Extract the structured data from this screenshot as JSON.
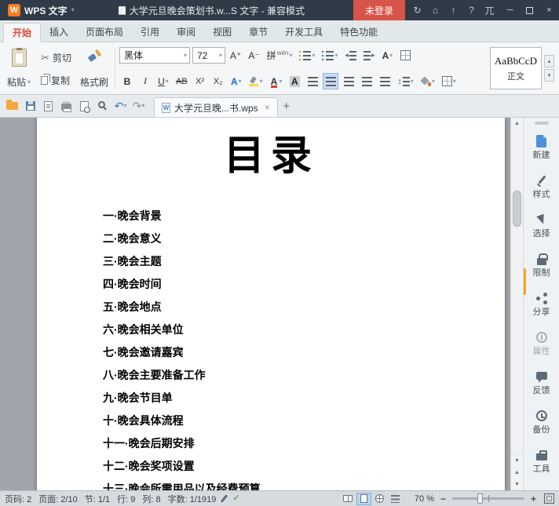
{
  "title_bar": {
    "logo_letter": "W",
    "app_name": "WPS 文字",
    "doc_title": "大学元旦晚会策划书.w...S 文字 - 兼容模式",
    "login_label": "未登录"
  },
  "tabs": [
    "开始",
    "插入",
    "页面布局",
    "引用",
    "审阅",
    "视图",
    "章节",
    "开发工具",
    "特色功能"
  ],
  "ribbon": {
    "paste": "粘贴",
    "cut": "剪切",
    "copy": "复制",
    "format_painter": "格式刷",
    "font_name": "黑体",
    "font_size": "72",
    "grow_font": "A⁺",
    "shrink_font": "A⁻",
    "pinyin": "拼",
    "pinyin_sub": "wén",
    "bold": "B",
    "italic": "I",
    "underline": "U",
    "strikethrough": "AB",
    "superscript": "X²",
    "subscript": "X₂",
    "style_preview": "AaBbCcD",
    "style_name": "正文"
  },
  "quick_bar": {
    "doc_tab": "大学元旦晚...书.wps"
  },
  "document": {
    "heading": "目录",
    "toc": [
      "一·晚会背景",
      "二·晚会意义",
      "三·晚会主题",
      "四·晚会时间",
      "五·晚会地点",
      "六·晚会相关单位",
      "七·晚会邀请嘉宾",
      "八·晚会主要准备工作",
      "九·晚会节目单",
      "十·晚会具体流程",
      "十一·晚会后期安排",
      "十二·晚会奖项设置",
      "十三·晚会所需用品以及经费预算"
    ]
  },
  "sidebar": {
    "items": [
      "新建",
      "样式",
      "选择",
      "限制",
      "分享",
      "属性",
      "反馈",
      "备份",
      "工具"
    ]
  },
  "status_bar": {
    "page_no": "页码: 2",
    "page_of": "页面: 2/10",
    "section": "节: 1/1",
    "line": "行: 9",
    "column": "列: 8",
    "word_count": "字数: 1/1919",
    "zoom": "70 %"
  },
  "icons": {
    "dropdown": "▾",
    "gal_up": "▴",
    "scissors": "✂",
    "undo": "↶",
    "redo": "↷",
    "sync": "↻",
    "home": "⌂",
    "upload": "↑",
    "help": "?",
    "skin": "兀",
    "minimize": "─",
    "close": "×",
    "letter_a": "A",
    "line_spacing": "↕",
    "outdent": "◂",
    "indent": "▸",
    "scroll_up": "▲",
    "scroll_down": "▼",
    "tab_close": "×",
    "new_tab": "+",
    "zoom_minus": "−",
    "zoom_plus": "+"
  },
  "colors": {
    "brand_orange": "#FF7A1A",
    "login_red": "#D8544A",
    "active_tab_red": "#DF4B3F",
    "selection_blue": "#C8DEF5",
    "new_doc_blue": "#4D8FD6",
    "accent_strip_orange": "#F5A623"
  }
}
